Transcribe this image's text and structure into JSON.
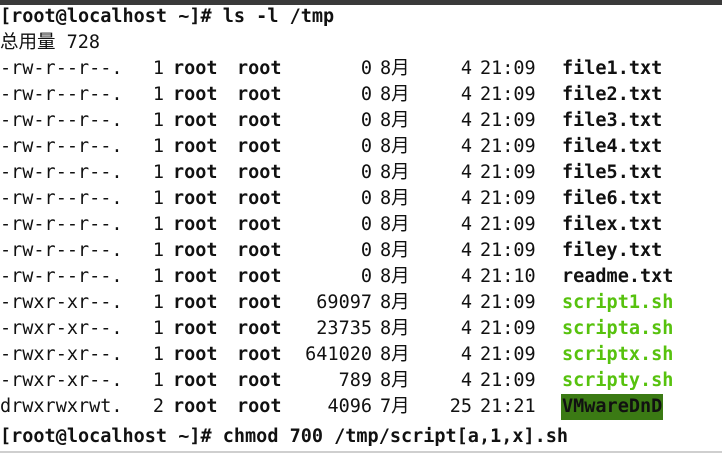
{
  "terminal": {
    "prompt1": "[root@localhost ~]# ",
    "command1": "ls -l /tmp",
    "total": "总用量 728",
    "rows": [
      {
        "perm": "-rw-r--r--.",
        "links": "1",
        "owner": "root",
        "group": "root",
        "size": "0",
        "month": "8月",
        "day": "4",
        "time": "21:09",
        "name": "file1.txt",
        "type": "file"
      },
      {
        "perm": "-rw-r--r--.",
        "links": "1",
        "owner": "root",
        "group": "root",
        "size": "0",
        "month": "8月",
        "day": "4",
        "time": "21:09",
        "name": "file2.txt",
        "type": "file"
      },
      {
        "perm": "-rw-r--r--.",
        "links": "1",
        "owner": "root",
        "group": "root",
        "size": "0",
        "month": "8月",
        "day": "4",
        "time": "21:09",
        "name": "file3.txt",
        "type": "file"
      },
      {
        "perm": "-rw-r--r--.",
        "links": "1",
        "owner": "root",
        "group": "root",
        "size": "0",
        "month": "8月",
        "day": "4",
        "time": "21:09",
        "name": "file4.txt",
        "type": "file"
      },
      {
        "perm": "-rw-r--r--.",
        "links": "1",
        "owner": "root",
        "group": "root",
        "size": "0",
        "month": "8月",
        "day": "4",
        "time": "21:09",
        "name": "file5.txt",
        "type": "file"
      },
      {
        "perm": "-rw-r--r--.",
        "links": "1",
        "owner": "root",
        "group": "root",
        "size": "0",
        "month": "8月",
        "day": "4",
        "time": "21:09",
        "name": "file6.txt",
        "type": "file"
      },
      {
        "perm": "-rw-r--r--.",
        "links": "1",
        "owner": "root",
        "group": "root",
        "size": "0",
        "month": "8月",
        "day": "4",
        "time": "21:09",
        "name": "filex.txt",
        "type": "file"
      },
      {
        "perm": "-rw-r--r--.",
        "links": "1",
        "owner": "root",
        "group": "root",
        "size": "0",
        "month": "8月",
        "day": "4",
        "time": "21:09",
        "name": "filey.txt",
        "type": "file"
      },
      {
        "perm": "-rw-r--r--.",
        "links": "1",
        "owner": "root",
        "group": "root",
        "size": "0",
        "month": "8月",
        "day": "4",
        "time": "21:10",
        "name": "readme.txt",
        "type": "file"
      },
      {
        "perm": "-rwxr-xr--.",
        "links": "1",
        "owner": "root",
        "group": "root",
        "size": "69097",
        "month": "8月",
        "day": "4",
        "time": "21:09",
        "name": "script1.sh",
        "type": "exec"
      },
      {
        "perm": "-rwxr-xr--.",
        "links": "1",
        "owner": "root",
        "group": "root",
        "size": "23735",
        "month": "8月",
        "day": "4",
        "time": "21:09",
        "name": "scripta.sh",
        "type": "exec"
      },
      {
        "perm": "-rwxr-xr--.",
        "links": "1",
        "owner": "root",
        "group": "root",
        "size": "641020",
        "month": "8月",
        "day": "4",
        "time": "21:09",
        "name": "scriptx.sh",
        "type": "exec"
      },
      {
        "perm": "-rwxr-xr--.",
        "links": "1",
        "owner": "root",
        "group": "root",
        "size": "789",
        "month": "8月",
        "day": "4",
        "time": "21:09",
        "name": "scripty.sh",
        "type": "exec"
      },
      {
        "perm": "drwxrwxrwt.",
        "links": "2",
        "owner": "root",
        "group": "root",
        "size": "4096",
        "month": "7月",
        "day": "25",
        "time": "21:21",
        "name": "VMwareDnD",
        "type": "dir"
      }
    ],
    "prompt2": "[root@localhost ~]# ",
    "command2": "chmod 700 /tmp/script[a,1,x].sh"
  },
  "colors": {
    "background": "#ffffff",
    "foreground": "#111111",
    "executable": "#57c20e",
    "sticky_dir_bg": "#3b7a14"
  }
}
